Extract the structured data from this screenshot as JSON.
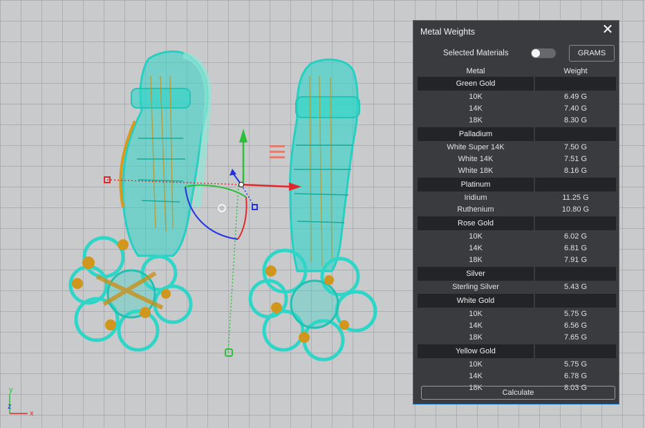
{
  "panel": {
    "title": "Metal Weights",
    "selected_materials_label": "Selected Materials",
    "toggle_on": false,
    "units_button": "GRAMS",
    "columns": {
      "metal": "Metal",
      "weight": "Weight"
    },
    "calculate_button": "Calculate"
  },
  "metals": [
    {
      "group": "Green Gold",
      "items": [
        {
          "name": "10K",
          "weight": "6.49 G"
        },
        {
          "name": "14K",
          "weight": "7.40 G"
        },
        {
          "name": "18K",
          "weight": "8.30 G"
        }
      ]
    },
    {
      "group": "Palladium",
      "items": [
        {
          "name": "White Super 14K",
          "weight": "7.50 G"
        },
        {
          "name": "White 14K",
          "weight": "7.51 G"
        },
        {
          "name": "White 18K",
          "weight": "8.16 G"
        }
      ]
    },
    {
      "group": "Platinum",
      "items": [
        {
          "name": "Iridium",
          "weight": "11.25 G"
        },
        {
          "name": "Ruthenium",
          "weight": "10.80 G"
        }
      ]
    },
    {
      "group": "Rose Gold",
      "items": [
        {
          "name": "10K",
          "weight": "6.02 G"
        },
        {
          "name": "14K",
          "weight": "6.81 G"
        },
        {
          "name": "18K",
          "weight": "7.91 G"
        }
      ]
    },
    {
      "group": "Silver",
      "items": [
        {
          "name": "Sterling Silver",
          "weight": "5.43 G"
        }
      ]
    },
    {
      "group": "White Gold",
      "items": [
        {
          "name": "10K",
          "weight": "5.75 G"
        },
        {
          "name": "14K",
          "weight": "6.56 G"
        },
        {
          "name": "18K",
          "weight": "7.65 G"
        }
      ]
    },
    {
      "group": "Yellow Gold",
      "items": [
        {
          "name": "10K",
          "weight": "5.75 G"
        },
        {
          "name": "14K",
          "weight": "6.78 G"
        },
        {
          "name": "18K",
          "weight": "8.03 G"
        }
      ]
    }
  ],
  "viewport": {
    "axis_labels": {
      "x": "x",
      "y": "y",
      "z": "z"
    },
    "colors": {
      "wire": "#2fd6c8",
      "gold": "#c9921b",
      "axis_x": "#e0282b",
      "axis_y": "#2bbf3a",
      "axis_z": "#2233dd",
      "panel_bg": "#3a3b3e",
      "panel_border": "#1f74c8"
    }
  }
}
